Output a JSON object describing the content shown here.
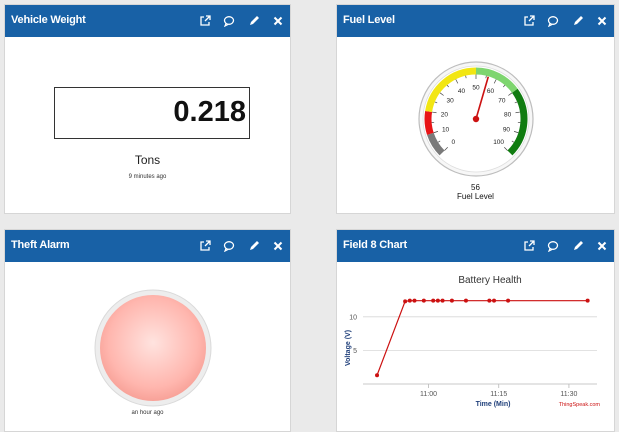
{
  "icons": [
    "external-link-icon",
    "comment-icon",
    "pencil-icon",
    "close-icon"
  ],
  "widgets": {
    "weight": {
      "title": "Vehicle Weight",
      "value": "0.218",
      "units": "Tons",
      "ago": "9 minutes ago"
    },
    "fuel": {
      "title": "Fuel Level",
      "value": 56,
      "value_text": "56",
      "label": "Fuel Level",
      "min": 0,
      "max": 100,
      "ticks": [
        "0",
        "10",
        "20",
        "30",
        "40",
        "50",
        "60",
        "70",
        "80",
        "90",
        "100"
      ],
      "bands": [
        {
          "from": 0,
          "to": 10,
          "color": "#7a7a7a"
        },
        {
          "from": 10,
          "to": 20,
          "color": "#e81416"
        },
        {
          "from": 20,
          "to": 50,
          "color": "#f2e613"
        },
        {
          "from": 50,
          "to": 70,
          "color": "#7ed56f"
        },
        {
          "from": 70,
          "to": 100,
          "color": "#107c10"
        }
      ],
      "needle_color": "#cc1111"
    },
    "theft": {
      "title": "Theft Alarm",
      "ago": "an hour ago",
      "lamp_color": "#ffb0a8",
      "state": "off"
    },
    "chart": {
      "title": "Field 8 Chart"
    }
  },
  "chart_data": {
    "type": "line",
    "title": "Battery Health",
    "xlabel": "Time (Min)",
    "ylabel": "Voltage (V)",
    "xticks": [
      "11:00",
      "11:15",
      "11:30"
    ],
    "yticks": [
      "5",
      "10"
    ],
    "ylim": [
      0,
      12.5
    ],
    "xlim": [
      "10:46",
      "11:36"
    ],
    "series": [
      {
        "color": "#cc1111",
        "x": [
          "10:49",
          "10:55",
          "10:56",
          "10:57",
          "10:59",
          "11:01",
          "11:02",
          "11:03",
          "11:05",
          "11:08",
          "11:13",
          "11:14",
          "11:17",
          "11:34"
        ],
        "y": [
          1.3,
          12.3,
          12.4,
          12.4,
          12.4,
          12.4,
          12.4,
          12.4,
          12.4,
          12.4,
          12.4,
          12.4,
          12.4,
          12.4
        ]
      }
    ],
    "credit": "ThingSpeak.com",
    "grid": true
  }
}
